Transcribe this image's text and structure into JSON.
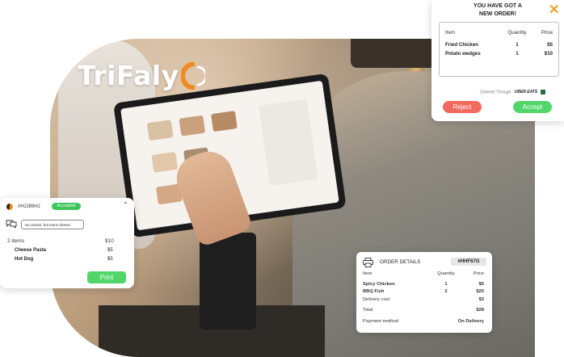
{
  "brand": {
    "name": "TriFaly"
  },
  "colors": {
    "accent_green": "#52d66a",
    "reject_red": "#f06a5d",
    "brand_orange": "#f08a22",
    "close_orange": "#f0a020"
  },
  "new_order": {
    "title_line1": "YOU HAVE GOT A",
    "title_line2": "NEW ORDER!",
    "close_icon": "close-icon",
    "headers": {
      "item": "Item",
      "quantity": "Quantity",
      "price": "Price"
    },
    "rows": [
      {
        "item": "Fried Chicken",
        "quantity": "1",
        "price": "$5"
      },
      {
        "item": "Potato wedges",
        "quantity": "1",
        "price": "$10"
      }
    ],
    "ordered_through_label": "Ordered Through",
    "ordered_through_service": "UBER EATS",
    "reject_label": "Reject",
    "accept_label": "Accept"
  },
  "ticket": {
    "order_id": "#HJJ89HJ",
    "status": "Accepted",
    "note": "No onions, but extra cheese",
    "items_count": "2 items",
    "total": "$10",
    "rows": [
      {
        "name": "Cheese Pasta",
        "price": "$5"
      },
      {
        "name": "Hot Dog",
        "price": "$5"
      }
    ],
    "print_label": "Print"
  },
  "order_details": {
    "title": "ORDER DETAILS",
    "order_id": "#HHF67G",
    "headers": {
      "item": "Item",
      "quantity": "Quantity",
      "price": "Price"
    },
    "rows": [
      {
        "item": "Spicy Chicken",
        "quantity": "1",
        "price": "$5"
      },
      {
        "item": "BBQ Fish",
        "quantity": "2",
        "price": "$20"
      }
    ],
    "delivery_label": "Delivery cost",
    "delivery_value": "$3",
    "total_label": "Total",
    "total_value": "$28",
    "payment_label": "Payment method",
    "payment_value": "On Delivery"
  }
}
